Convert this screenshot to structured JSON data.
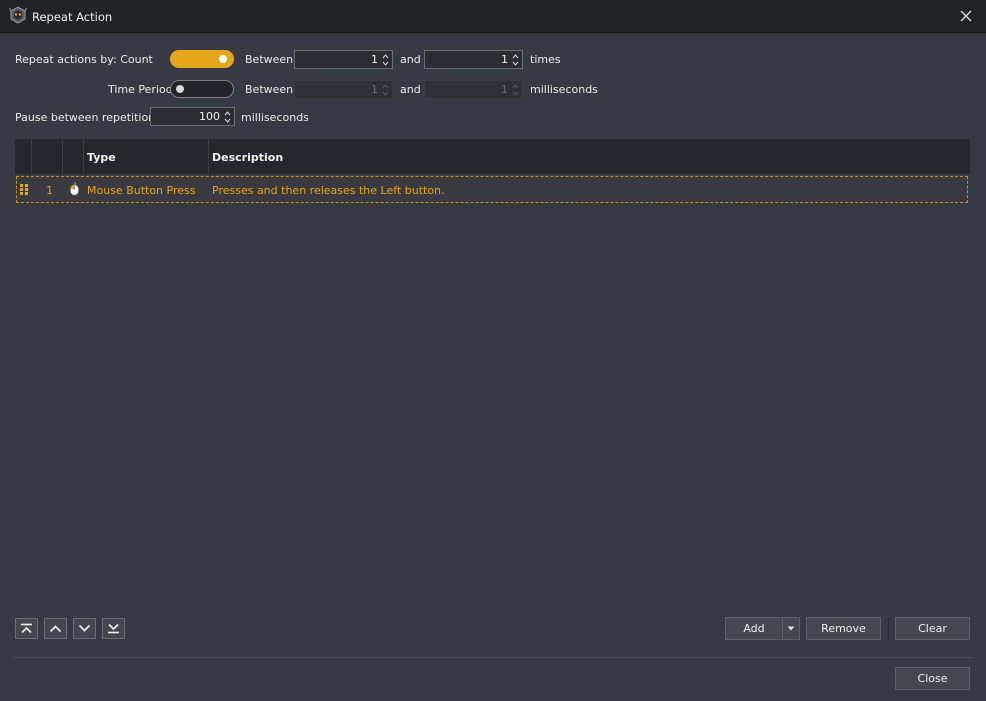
{
  "window": {
    "title": "Repeat Action"
  },
  "repeat": {
    "label": "Repeat actions by: Count",
    "count_on": true,
    "count_between_label": "Between",
    "count_min": "1",
    "count_and_label": "and",
    "count_max": "1",
    "count_unit": "times",
    "time_label": "Time Period",
    "time_on": false,
    "time_between_label": "Between",
    "time_min": "1",
    "time_and_label": "and",
    "time_max": "1",
    "time_unit": "milliseconds"
  },
  "pause": {
    "label": "Pause between repetitions",
    "value": "100",
    "unit": "milliseconds"
  },
  "table": {
    "columns": [
      "",
      "",
      "",
      "Type",
      "Description"
    ],
    "rows": [
      {
        "index": "1",
        "icon": "mouse-icon",
        "type": "Mouse Button Press",
        "description": "Presses and then releases the Left button."
      }
    ]
  },
  "buttons": {
    "add": "Add",
    "remove": "Remove",
    "clear": "Clear",
    "close": "Close"
  },
  "colors": {
    "accent": "#e6a61c",
    "background": "#373a42",
    "header": "#26282d"
  }
}
